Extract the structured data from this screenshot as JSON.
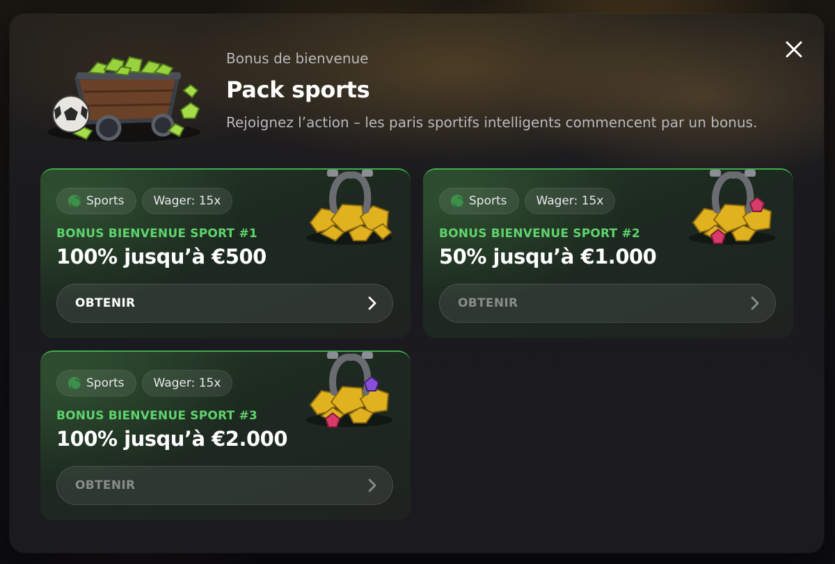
{
  "modal": {
    "kicker": "Bonus de bienvenue",
    "title": "Pack sports",
    "subtitle": "Rejoignez l’action – les paris sportifs intelligents commencent par un bonus."
  },
  "offers": [
    {
      "tag_sport": "Sports",
      "tag_wager": "Wager: 15x",
      "name": "BONUS BIENVENUE SPORT #1",
      "amount": "100% jusqu’à €500",
      "cta": "OBTENIR",
      "cta_state": "active",
      "art": "horseshoe-gold-icon"
    },
    {
      "tag_sport": "Sports",
      "tag_wager": "Wager: 15x",
      "name": "BONUS BIENVENUE SPORT #2",
      "amount": "50% jusqu’à €1.000",
      "cta": "OBTENIR",
      "cta_state": "disabled",
      "art": "horseshoe-gold-pink-gem-icon"
    },
    {
      "tag_sport": "Sports",
      "tag_wager": "Wager: 15x",
      "name": "BONUS BIENVENUE SPORT #3",
      "amount": "100% jusqu’à €2.000",
      "cta": "OBTENIR",
      "cta_state": "disabled",
      "art": "horseshoe-gold-purple-gem-icon"
    }
  ],
  "colors": {
    "accent_green": "#5fd36e",
    "card_border": "#3fae4f",
    "modal_bg": "#1b1b1f"
  }
}
